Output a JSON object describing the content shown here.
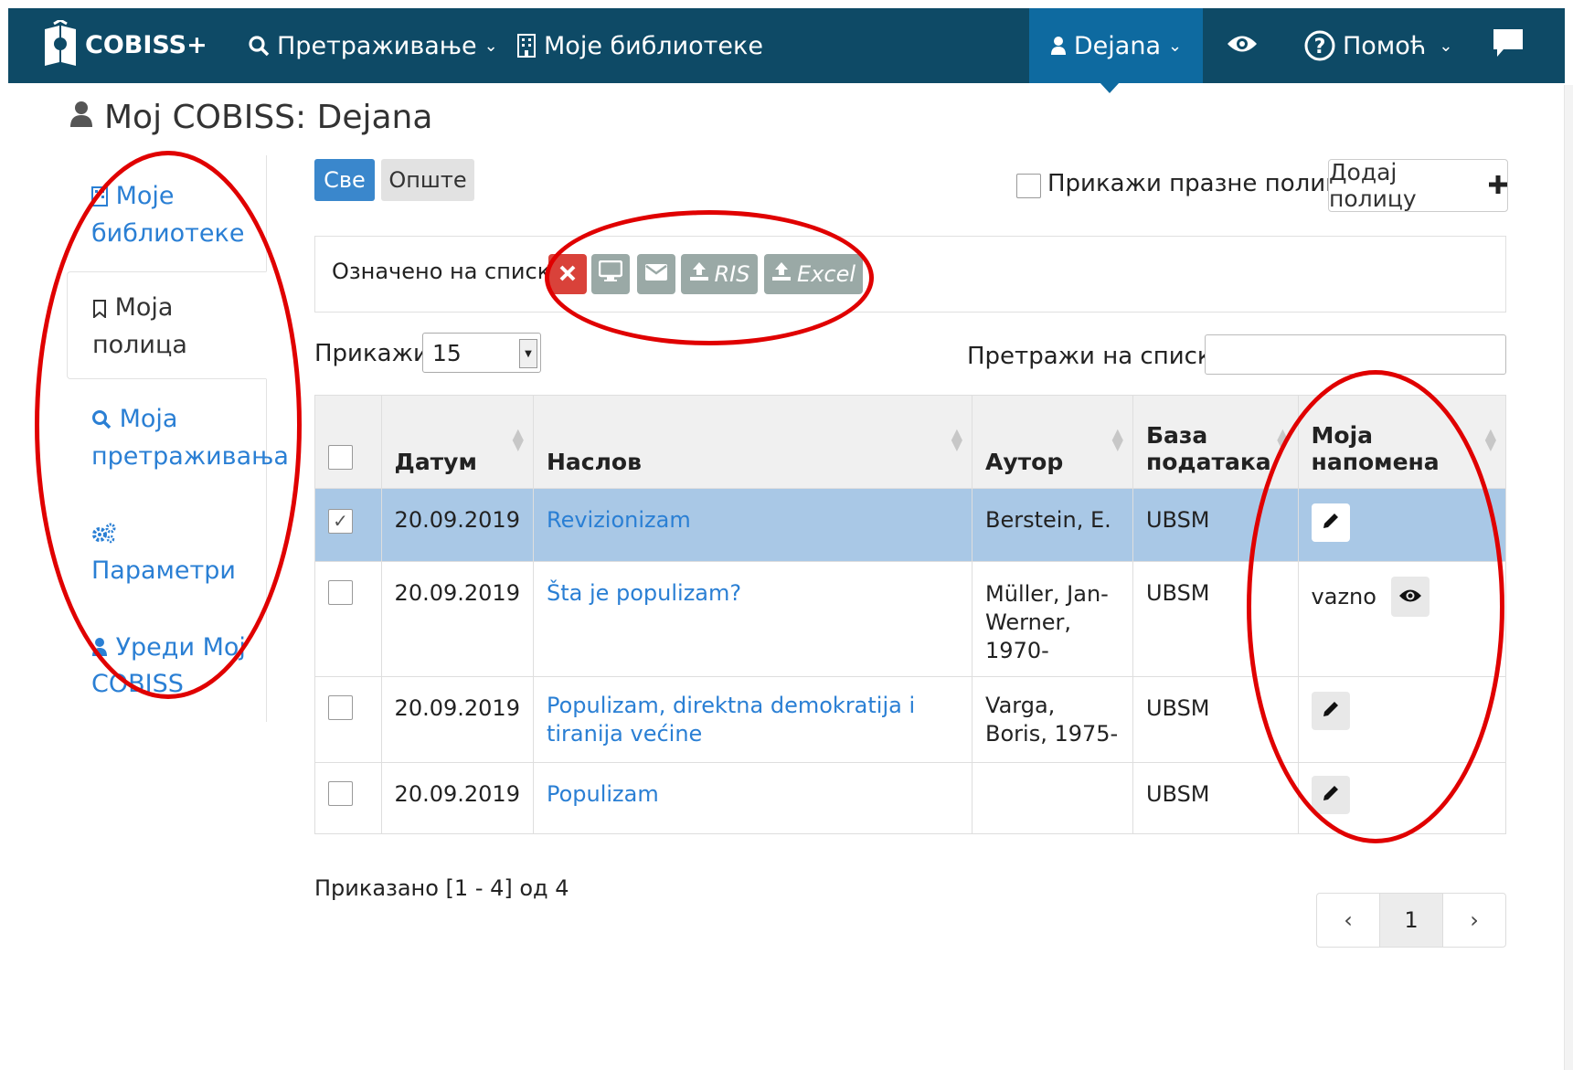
{
  "topbar": {
    "brand": "COBISS+",
    "nav": {
      "search": "Претраживање",
      "libraries": "Моје библиотеке",
      "user": "Dejana",
      "help": "Помоћ"
    }
  },
  "page": {
    "title": "Moj COBISS: Dejana"
  },
  "sidebar": {
    "items": [
      {
        "label": "Моје библиотеке",
        "icon": "building-icon"
      },
      {
        "label": "Моја полица",
        "icon": "bookmark-icon"
      },
      {
        "label": "Моја претраживања",
        "icon": "search-icon"
      },
      {
        "label": "Параметри",
        "icon": "gears-icon"
      },
      {
        "label": "Уреди Moj COBISS",
        "icon": "user-icon"
      }
    ]
  },
  "filters": {
    "all": "Све",
    "general": "Опште"
  },
  "shelf": {
    "show_empty": "Прикажи празне полице",
    "add_shelf": "Додај полицу"
  },
  "marked": {
    "label": "Означено на списку",
    "ris": "RIS",
    "excel": "Excel"
  },
  "list_controls": {
    "show_label": "Прикажи",
    "show_value": "15",
    "search_label": "Претражи на списку:",
    "search_value": ""
  },
  "table": {
    "headers": [
      "Датум",
      "Наслов",
      "Аутор",
      "База података",
      "Моја напомена"
    ],
    "rows": [
      {
        "checked": true,
        "date": "20.09.2019",
        "title": "Revizionizam",
        "author": "Berstein, E.",
        "db": "UBSM",
        "note": ""
      },
      {
        "checked": false,
        "date": "20.09.2019",
        "title": "Šta je populizam?",
        "author": "Müller, Jan-Werner, 1970-",
        "db": "UBSM",
        "note": "vazno"
      },
      {
        "checked": false,
        "date": "20.09.2019",
        "title": "Populizam, direktna demokratija i tiranija većine",
        "author": "Varga, Boris, 1975-",
        "db": "UBSM",
        "note": ""
      },
      {
        "checked": false,
        "date": "20.09.2019",
        "title": "Populizam",
        "author": "",
        "db": "UBSM",
        "note": ""
      }
    ]
  },
  "footer": {
    "shown": "Приказано [1 - 4] од 4",
    "page": "1",
    "prev": "‹",
    "next": "›"
  },
  "colors": {
    "topbar": "#0e4a66",
    "user_tab": "#0e6aa0",
    "primary": "#3a87cc",
    "danger": "#d9423a",
    "action_grey": "#9aa9a6",
    "selected_row": "#a9c8e6",
    "annotation": "#e00000"
  }
}
